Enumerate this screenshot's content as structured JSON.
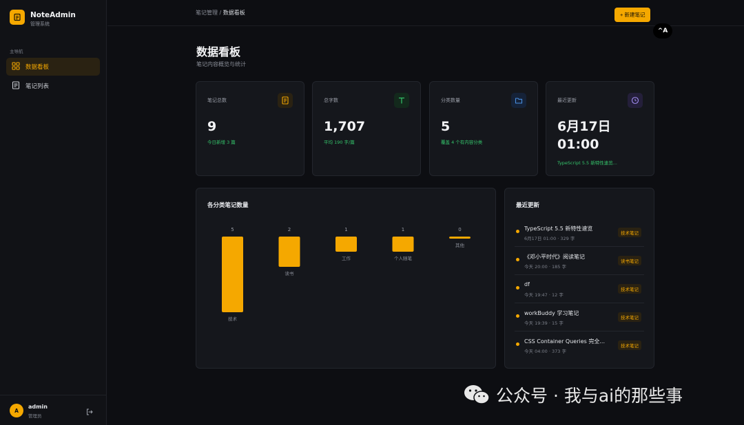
{
  "brand": {
    "name": "NoteAdmin",
    "subtitle": "管理系统"
  },
  "sidebar": {
    "section_label": "主导航",
    "items": [
      {
        "label": "数据看板",
        "icon": "grid-icon",
        "active": true
      },
      {
        "label": "笔记列表",
        "icon": "document-icon",
        "active": false
      }
    ]
  },
  "user": {
    "initial": "A",
    "name": "admin",
    "role": "管理员"
  },
  "header": {
    "breadcrumb_root": "笔记管理",
    "breadcrumb_sep": " / ",
    "breadcrumb_current": "数据看板",
    "new_button_label": "+ 新建笔记",
    "floating_label": "^A"
  },
  "page": {
    "title": "数据看板",
    "subtitle": "笔记内容概览与统计"
  },
  "stats": [
    {
      "label": "笔记总数",
      "value": "9",
      "note": "今日新增 3 篇",
      "icon": "document-icon",
      "icon_color": "#f5a800"
    },
    {
      "label": "总字数",
      "value": "1,707",
      "note": "平均 190 字/篇",
      "icon": "text-icon",
      "icon_color": "#35c46b"
    },
    {
      "label": "分类数量",
      "value": "5",
      "note": "覆盖 4 个有内容分类",
      "icon": "folder-icon",
      "icon_color": "#4a90e2"
    },
    {
      "label": "最近更新",
      "value": "6月17日 01:00",
      "note": "TypeScript 5.5 新特性速览...",
      "icon": "clock-icon",
      "icon_color": "#a08cf0"
    }
  ],
  "chart_panel": {
    "title": "各分类笔记数量"
  },
  "chart_data": {
    "type": "bar",
    "categories": [
      "技术",
      "读书",
      "工作",
      "个人随笔",
      "其他"
    ],
    "values": [
      5,
      2,
      1,
      1,
      0
    ],
    "title": "各分类笔记数量",
    "ylim": [
      0,
      5
    ],
    "color": "#f5a800",
    "grid": false
  },
  "recent_panel": {
    "title": "最近更新",
    "items": [
      {
        "title": "TypeScript 5.5 新特性速览",
        "meta": "6月17日 01:00 · 329 字",
        "tag": "技术笔记"
      },
      {
        "title": "《邓小平时代》阅读笔记",
        "meta": "今天 20:00 · 185 字",
        "tag": "读书笔记"
      },
      {
        "title": "df",
        "meta": "今天 19:47 · 12 字",
        "tag": "技术笔记"
      },
      {
        "title": "workBuddy 学习笔记",
        "meta": "今天 19:39 · 15 字",
        "tag": "技术笔记"
      },
      {
        "title": "CSS Container Queries 完全...",
        "meta": "今天 04:00 · 373 字",
        "tag": "技术笔记"
      }
    ]
  },
  "watermark": {
    "text": "公众号 · 我与ai的那些事"
  },
  "colors": {
    "accent": "#f5a800",
    "success": "#35c46b",
    "background": "#0d0e12",
    "card": "#15171c"
  }
}
